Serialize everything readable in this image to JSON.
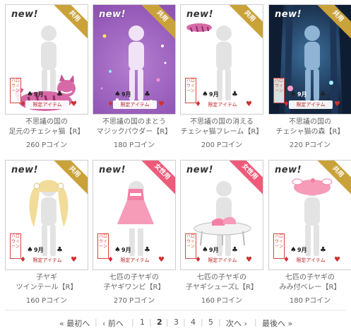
{
  "badges": {
    "new": "new!",
    "shared": "共用",
    "female": "女性用"
  },
  "thumb_text": {
    "stamp": "ハロウィーン",
    "month": "9月",
    "limited": "限定アイテム"
  },
  "items": [
    {
      "name_line1": "不思議の国の",
      "name_line2": "足元のチェシャ猫【R】",
      "price": "260 Pコイン",
      "badge": "共用",
      "theme": "white",
      "has_stamp": true
    },
    {
      "name_line1": "不思議の国のまとう",
      "name_line2": "マジックパウダー【R】",
      "price": "180 Pコイン",
      "badge": "共用",
      "theme": "purple",
      "has_stamp": false
    },
    {
      "name_line1": "不思議の国の消える",
      "name_line2": "チェシャ猫フレーム【R】",
      "price": "200 Pコイン",
      "badge": "共用",
      "theme": "white",
      "has_stamp": true
    },
    {
      "name_line1": "不思議の国の",
      "name_line2": "チェシャ猫の森【R】",
      "price": "220 Pコイン",
      "badge": "共用",
      "theme": "forest",
      "has_stamp": true
    },
    {
      "name_line1": "子ヤギ",
      "name_line2": "ツインテール【R】",
      "price": "160 Pコイン",
      "badge": "共用",
      "theme": "white",
      "has_stamp": true
    },
    {
      "name_line1": "七匹の子ヤギの",
      "name_line2": "子ヤギワンピ【R】",
      "price": "270 Pコイン",
      "badge": "女性用",
      "theme": "white",
      "has_stamp": true
    },
    {
      "name_line1": "七匹の子ヤギの",
      "name_line2": "子ヤギシューズL【R】",
      "price": "160 Pコイン",
      "badge": "女性用",
      "theme": "white",
      "has_stamp": true
    },
    {
      "name_line1": "七匹の子ヤギの",
      "name_line2": "みみ付ベレー【R】",
      "price": "180 Pコイン",
      "badge": "共用",
      "theme": "white",
      "has_stamp": true
    }
  ],
  "pager": {
    "first": "« 最初へ",
    "prev": "‹ 前へ",
    "pages": [
      "1",
      "2",
      "3",
      "4",
      "5"
    ],
    "current": "2",
    "next": "次へ ›",
    "last": "最後へ »"
  }
}
